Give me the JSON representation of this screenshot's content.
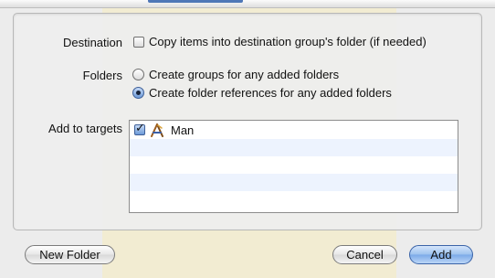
{
  "dialog": {
    "destination": {
      "label": "Destination",
      "option_label": "Copy items into destination group's folder (if needed)",
      "checked": false
    },
    "folders": {
      "label": "Folders",
      "options": [
        {
          "label": "Create groups for any added folders",
          "selected": false
        },
        {
          "label": "Create folder references for any added folders",
          "selected": true
        }
      ]
    },
    "targets": {
      "label": "Add to targets",
      "items": [
        {
          "name": "Man",
          "checked": true,
          "icon": "application-icon"
        }
      ]
    },
    "buttons": {
      "new_folder": "New Folder",
      "cancel": "Cancel",
      "add": "Add"
    }
  },
  "colors": {
    "dialog_background": "#ececec",
    "list_alternate_row": "#edf3fe",
    "default_button": "#7aa9e8",
    "selection_accent": "#6d9ad8"
  }
}
